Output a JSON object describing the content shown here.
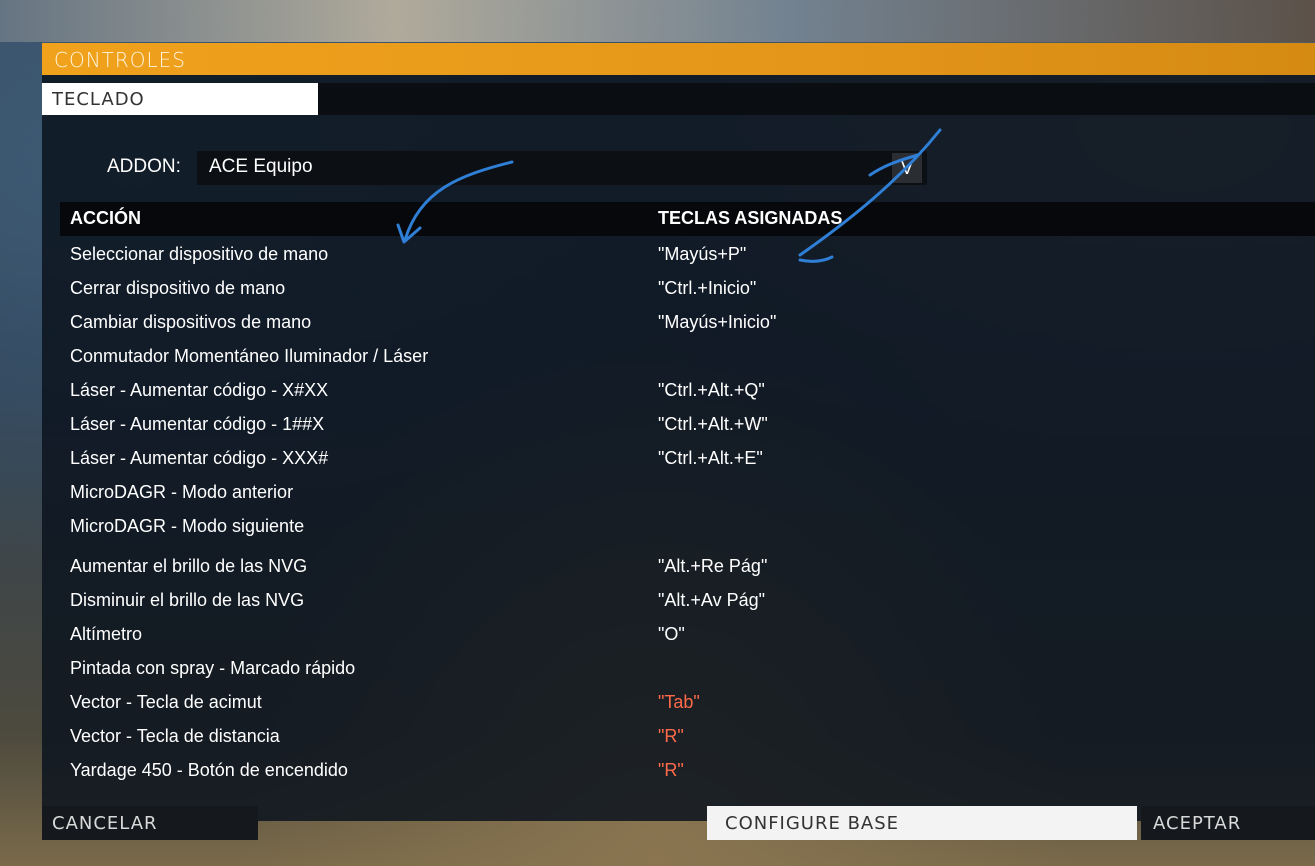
{
  "window": {
    "title": "CONTROLES",
    "tabs": [
      {
        "label": "TECLADO",
        "active": true
      }
    ]
  },
  "addon": {
    "label": "ADDON:",
    "selected": "ACE Equipo",
    "dropdown_glyph": "V"
  },
  "table": {
    "headers": {
      "action": "ACCIÓN",
      "keys": "TECLAS ASIGNADAS"
    },
    "rows": [
      {
        "action": "Seleccionar dispositivo de mano",
        "keys": "\"Mayús+P\"",
        "conflict": false
      },
      {
        "action": "Cerrar dispositivo de mano",
        "keys": "\"Ctrl.+Inicio\"",
        "conflict": false
      },
      {
        "action": "Cambiar dispositivos de mano",
        "keys": "\"Mayús+Inicio\"",
        "conflict": false
      },
      {
        "action": "Conmutador Momentáneo Iluminador / Láser",
        "keys": "",
        "conflict": false
      },
      {
        "action": "Láser - Aumentar código - X#XX",
        "keys": "\"Ctrl.+Alt.+Q\"",
        "conflict": false
      },
      {
        "action": "Láser - Aumentar código - 1##X",
        "keys": "\"Ctrl.+Alt.+W\"",
        "conflict": false
      },
      {
        "action": "Láser - Aumentar código - XXX#",
        "keys": "\"Ctrl.+Alt.+E\"",
        "conflict": false
      },
      {
        "action": "MicroDAGR - Modo anterior",
        "keys": "",
        "conflict": false
      },
      {
        "action": "MicroDAGR - Modo siguiente",
        "keys": "",
        "conflict": false
      },
      {
        "action": "Aumentar el brillo de las NVG",
        "keys": "\"Alt.+Re Pág\"",
        "conflict": false
      },
      {
        "action": "Disminuir el brillo de las NVG",
        "keys": "\"Alt.+Av Pág\"",
        "conflict": false
      },
      {
        "action": "Altímetro",
        "keys": "\"O\"",
        "conflict": false
      },
      {
        "action": "Pintada con spray - Marcado rápido",
        "keys": "",
        "conflict": false
      },
      {
        "action": "Vector - Tecla de acimut",
        "keys": "\"Tab\"",
        "conflict": true
      },
      {
        "action": "Vector - Tecla de distancia",
        "keys": "\"R\"",
        "conflict": true
      },
      {
        "action": "Yardage 450 - Botón de encendido",
        "keys": "\"R\"",
        "conflict": true
      }
    ]
  },
  "buttons": {
    "cancel": "CANCELAR",
    "configure_base": "CONFIGURE BASE",
    "accept": "ACEPTAR"
  },
  "colors": {
    "accent": "#f0a21c",
    "conflict": "#ff6a4a",
    "annotation": "#2f7fd6"
  }
}
